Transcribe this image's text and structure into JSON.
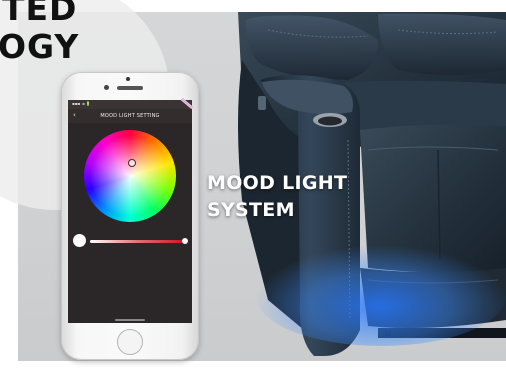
{
  "banner": {
    "headline_line1": "TED",
    "headline_line2": "OGY",
    "feature_line1": "MOOD LIGHT",
    "feature_line2": "SYSTEM"
  },
  "phone_app": {
    "status_text": "▪▪▪ ◄ 🔋",
    "back_icon": "‹",
    "screen_title": "MOOD LIGHT SETTING",
    "brightness_level": 1.0
  },
  "colors": {
    "panel": "#d0d2d4",
    "leather": "#24313d",
    "glow": "#2a7bff",
    "text_white": "#ffffff",
    "headline": "#111111"
  },
  "icons": {
    "back": "back-arrow-icon",
    "color_picker": "color-wheel-icon",
    "home": "home-button-icon"
  }
}
